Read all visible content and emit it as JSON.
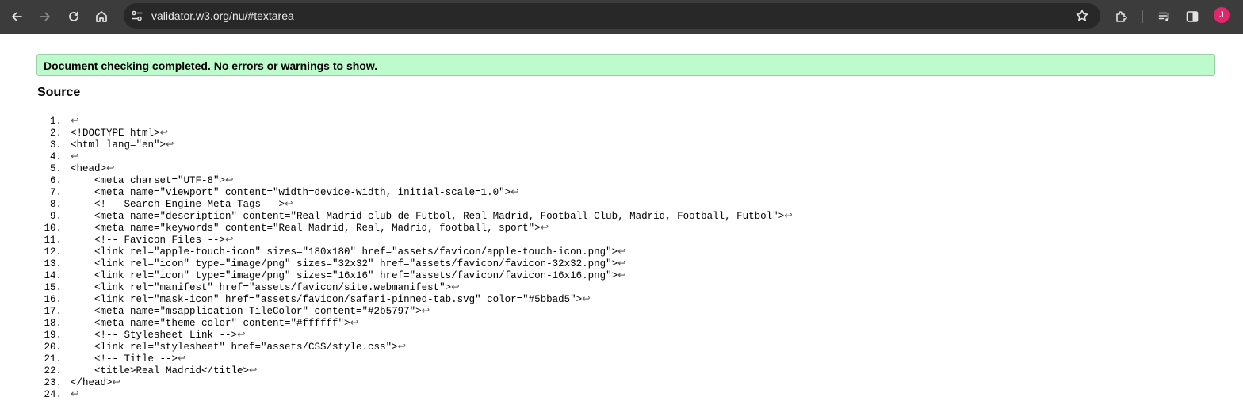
{
  "browser": {
    "url": "validator.w3.org/nu/#textarea",
    "avatar_letter": "J",
    "avatar_color": "#e2266e"
  },
  "result": {
    "message": "Document checking completed. No errors or warnings to show."
  },
  "source": {
    "heading": "Source",
    "line_break_glyph": "↩",
    "lines": [
      {
        "n": "1.",
        "text": ""
      },
      {
        "n": "2.",
        "text": "<!DOCTYPE html>"
      },
      {
        "n": "3.",
        "text": "<html lang=\"en\">"
      },
      {
        "n": "4.",
        "text": ""
      },
      {
        "n": "5.",
        "text": "<head>"
      },
      {
        "n": "6.",
        "text": "    <meta charset=\"UTF-8\">"
      },
      {
        "n": "7.",
        "text": "    <meta name=\"viewport\" content=\"width=device-width, initial-scale=1.0\">"
      },
      {
        "n": "8.",
        "text": "    <!-- Search Engine Meta Tags -->"
      },
      {
        "n": "9.",
        "text": "    <meta name=\"description\" content=\"Real Madrid club de Futbol, Real Madrid, Football Club, Madrid, Football, Futbol\">"
      },
      {
        "n": "10.",
        "text": "    <meta name=\"keywords\" content=\"Real Madrid, Real, Madrid, football, sport\">"
      },
      {
        "n": "11.",
        "text": "    <!-- Favicon Files -->"
      },
      {
        "n": "12.",
        "text": "    <link rel=\"apple-touch-icon\" sizes=\"180x180\" href=\"assets/favicon/apple-touch-icon.png\">"
      },
      {
        "n": "13.",
        "text": "    <link rel=\"icon\" type=\"image/png\" sizes=\"32x32\" href=\"assets/favicon/favicon-32x32.png\">"
      },
      {
        "n": "14.",
        "text": "    <link rel=\"icon\" type=\"image/png\" sizes=\"16x16\" href=\"assets/favicon/favicon-16x16.png\">"
      },
      {
        "n": "15.",
        "text": "    <link rel=\"manifest\" href=\"assets/favicon/site.webmanifest\">"
      },
      {
        "n": "16.",
        "text": "    <link rel=\"mask-icon\" href=\"assets/favicon/safari-pinned-tab.svg\" color=\"#5bbad5\">"
      },
      {
        "n": "17.",
        "text": "    <meta name=\"msapplication-TileColor\" content=\"#2b5797\">"
      },
      {
        "n": "18.",
        "text": "    <meta name=\"theme-color\" content=\"#ffffff\">"
      },
      {
        "n": "19.",
        "text": "    <!-- Stylesheet Link -->"
      },
      {
        "n": "20.",
        "text": "    <link rel=\"stylesheet\" href=\"assets/CSS/style.css\">"
      },
      {
        "n": "21.",
        "text": "    <!-- Title -->"
      },
      {
        "n": "22.",
        "text": "    <title>Real Madrid</title>"
      },
      {
        "n": "23.",
        "text": "</head>"
      },
      {
        "n": "24.",
        "text": ""
      }
    ]
  }
}
